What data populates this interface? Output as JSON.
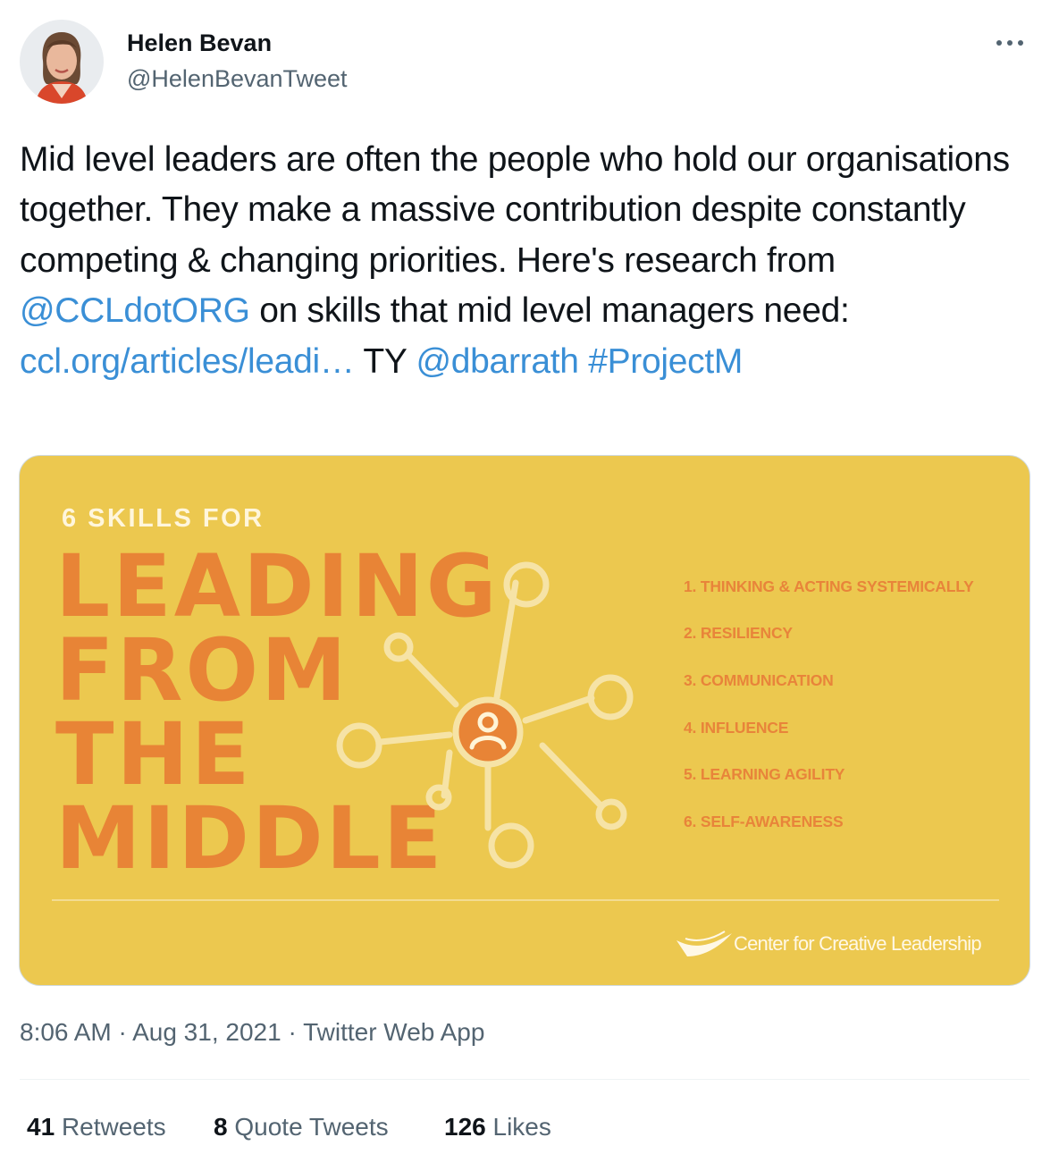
{
  "tweet": {
    "display_name": "Helen Bevan",
    "handle": "@HelenBevanTweet",
    "text": {
      "p1": "Mid level leaders are often the people who hold our organisations together. They make a massive contribution despite constantly competing & changing priorities. Here's research from ",
      "mention1": "@CCLdotORG",
      "p2": " on skills that mid level managers need: ",
      "url": "ccl.org/articles/leadi…",
      "p3": " TY ",
      "mention2": "@dbarrath",
      "p4": " ",
      "hashtag": "#ProjectM"
    },
    "more_icon": "more-dots-icon",
    "link_color": "#3a8fd6"
  },
  "card": {
    "kicker": "6 SKILLS FOR",
    "headline": [
      "LEADING",
      "FROM",
      "THE",
      "MIDDLE"
    ],
    "skills": [
      "1. THINKING & ACTING SYSTEMICALLY",
      "2. RESILIENCY",
      "3. COMMUNICATION",
      "4. INFLUENCE",
      "5. LEARNING AGILITY",
      "6. SELF-AWARENESS"
    ],
    "org_name": "Center for Creative Leadership",
    "background_color": "#ecc84f",
    "accent_color": "#e88436",
    "network_icon": "network-person-icon"
  },
  "meta": {
    "time": "8:06 AM",
    "sep1": " · ",
    "date": "Aug 31, 2021",
    "sep2": " · ",
    "source": "Twitter Web App"
  },
  "stats": {
    "retweets_count": "41",
    "retweets_label": "Retweets",
    "quotes_count": "8",
    "quotes_label": "Quote Tweets",
    "likes_count": "126",
    "likes_label": "Likes"
  }
}
